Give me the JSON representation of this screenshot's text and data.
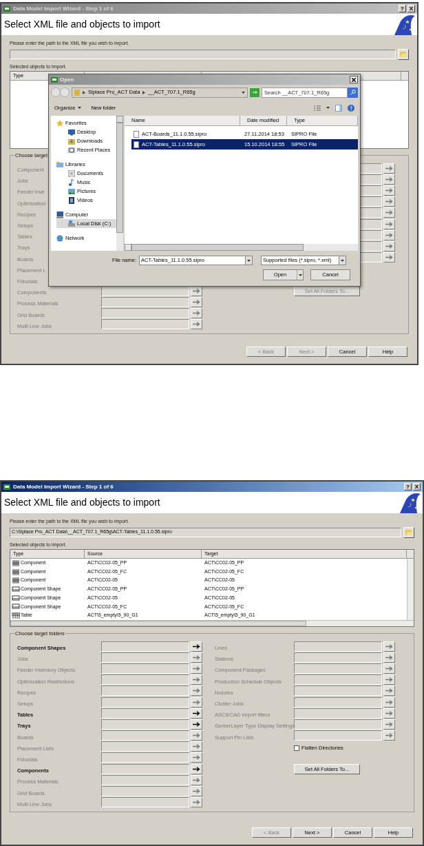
{
  "wizards": [
    {
      "title": "Data Model Import Wizard - Step 1 of 6",
      "active": false,
      "title_buttons": [
        "?",
        "X"
      ],
      "heading": "Select XML file and objects to import",
      "path_label": "Please enter the path to the XML file you wish to import.",
      "objects_label": "Selected objects to import.",
      "columns": [
        "Type"
      ],
      "folders_label": "Choose target",
      "left_folders": [
        {
          "label": "Component",
          "kind": "label_only",
          "enabled": false
        },
        {
          "label": "Jobs",
          "kind": "label_only",
          "enabled": false
        },
        {
          "label": "Feeder Inve",
          "kind": "label_only",
          "enabled": false
        },
        {
          "label": "Optimization",
          "kind": "label_only",
          "enabled": false
        },
        {
          "label": "Recipes",
          "kind": "label_only",
          "enabled": false
        },
        {
          "label": "Setups",
          "kind": "label_only",
          "enabled": false
        },
        {
          "label": "Tables",
          "kind": "label_only",
          "enabled": false
        },
        {
          "label": "Trays",
          "kind": "label_only",
          "enabled": false
        },
        {
          "label": "Boards",
          "kind": "label_only",
          "enabled": false
        },
        {
          "label": "Placement L",
          "kind": "label_only",
          "enabled": false
        },
        {
          "label": "Fiducials",
          "kind": "label_only",
          "enabled": false
        },
        {
          "label": "Components",
          "kind": "full",
          "enabled": false
        },
        {
          "label": "Process Materials",
          "kind": "full",
          "enabled": false
        },
        {
          "label": "Grid Boards",
          "kind": "full",
          "enabled": false
        },
        {
          "label": "Multi Line Jobs",
          "kind": "full",
          "enabled": false
        }
      ],
      "right_folders": [
        {
          "enabled": false
        },
        {
          "enabled": false
        },
        {
          "enabled": false
        },
        {
          "enabled": false
        },
        {
          "enabled": false
        },
        {
          "enabled": false
        },
        {
          "enabled": false
        },
        {
          "enabled": false
        },
        {
          "enabled": false
        }
      ],
      "set_all": {
        "label": "Set All Folders To...",
        "disabled": true
      },
      "buttons": [
        {
          "label": "< Back",
          "disabled": true
        },
        {
          "label": "Next >",
          "disabled": true
        },
        {
          "label": "Cancel",
          "disabled": false
        },
        {
          "label": "Help",
          "disabled": false
        }
      ],
      "open_dialog": {
        "title": "Open",
        "breadcrumb": [
          "Siplace Pro_ACT Data",
          "__ACT_707.1_R65g"
        ],
        "search_placeholder": "Search __ACT_707.1_R65g",
        "toolbar": [
          "Organize",
          "New folder"
        ],
        "nav": [
          {
            "label": "Favorites",
            "kind": "star",
            "selected": false,
            "children": [
              {
                "label": "Desktop",
                "kind": "desktop",
                "selected": false
              },
              {
                "label": "Downloads",
                "kind": "downloads",
                "selected": false
              },
              {
                "label": "Recent Places",
                "kind": "recent",
                "selected": false
              }
            ]
          },
          {
            "label": "Libraries",
            "kind": "library",
            "selected": false,
            "children": [
              {
                "label": "Documents",
                "kind": "documents",
                "selected": false
              },
              {
                "label": "Music",
                "kind": "music",
                "selected": false
              },
              {
                "label": "Pictures",
                "kind": "pictures",
                "selected": false
              },
              {
                "label": "Videos",
                "kind": "videos",
                "selected": false
              }
            ]
          },
          {
            "label": "Computer",
            "kind": "computer",
            "selected": false,
            "children": [
              {
                "label": "Local Disk (C:)",
                "kind": "disk",
                "selected": true
              }
            ]
          },
          {
            "label": "Network",
            "kind": "network",
            "selected": false
          }
        ],
        "columns": [
          "Name",
          "Date modified",
          "Type"
        ],
        "files": [
          {
            "name": "ACT-Boards_11.1.0.55.sipro",
            "date": "27.11.2014 18:53",
            "type": "SIPRO File",
            "selected": false
          },
          {
            "name": "ACT-Tables_11.1.0.55.sipro",
            "date": "15.10.2014 18:55",
            "type": "SIPRO File",
            "selected": true
          }
        ],
        "file_name_label": "File name:",
        "file_name": "ACT-Tables_11.1.0.55.sipro",
        "filter": "Supported files (*.sipro, *.xml)",
        "buttons": [
          "Open",
          "Cancel"
        ]
      }
    },
    {
      "title": "Data Model Import Wizard - Step 1 of 6",
      "active": true,
      "title_buttons": [
        "?",
        "X"
      ],
      "heading": "Select XML file and objects to import",
      "path_label": "Please enter the path to the XML file you wish to import.",
      "path_value": "C:\\Siplace Pro_ACT Data\\__ACT_707.1_R65g\\ACT-Tables_11.1.0.55.sipro",
      "objects_label": "Selected objects to import.",
      "columns": [
        "Type",
        "Source",
        "Target"
      ],
      "rows": [
        {
          "kind": "component",
          "type": "Component",
          "source": "ACT\\CC02-05_PP",
          "target": "ACT\\CC02-05_PP"
        },
        {
          "kind": "component",
          "type": "Component",
          "source": "ACT\\CC02-05_FC",
          "target": "ACT\\CC02-05_FC"
        },
        {
          "kind": "component",
          "type": "Component",
          "source": "ACT\\CC02-05",
          "target": "ACT\\CC02-05"
        },
        {
          "kind": "shape",
          "type": "Component Shape",
          "source": "ACT\\CC02-05_PP",
          "target": "ACT\\CC02-05_PP"
        },
        {
          "kind": "shape",
          "type": "Component Shape",
          "source": "ACT\\CC02-05",
          "target": "ACT\\CC02-05"
        },
        {
          "kind": "shape",
          "type": "Component Shape",
          "source": "ACT\\CC02-05_FC",
          "target": "ACT\\CC02-05_FC"
        },
        {
          "kind": "table",
          "type": "Table",
          "source": "ACT\\5_empty\\5_90_G1",
          "target": "ACT\\5_empty\\5_90_G1"
        }
      ],
      "folders_label": "Choose target folders",
      "left_folders": [
        {
          "label": "Component Shapes",
          "kind": "full",
          "enabled": true
        },
        {
          "label": "Jobs",
          "kind": "full",
          "enabled": false
        },
        {
          "label": "Feeder Inventory Objects",
          "kind": "full",
          "enabled": false
        },
        {
          "label": "Optimization Restrictions",
          "kind": "full",
          "enabled": false
        },
        {
          "label": "Recipes",
          "kind": "full",
          "enabled": false
        },
        {
          "label": "Setups",
          "kind": "full",
          "enabled": false
        },
        {
          "label": "Tables",
          "kind": "full",
          "enabled": true
        },
        {
          "label": "Trays",
          "kind": "full",
          "enabled": true
        },
        {
          "label": "Boards",
          "kind": "full",
          "enabled": false
        },
        {
          "label": "Placement Lists",
          "kind": "full",
          "enabled": false
        },
        {
          "label": "Fiducials",
          "kind": "full",
          "enabled": false
        },
        {
          "label": "Components",
          "kind": "full",
          "enabled": true
        },
        {
          "label": "Process Materials",
          "kind": "full",
          "enabled": false
        },
        {
          "label": "Grid Boards",
          "kind": "full",
          "enabled": false
        },
        {
          "label": "Multi Line Jobs",
          "kind": "full",
          "enabled": false
        }
      ],
      "right_folders": [
        {
          "label": "Lines",
          "enabled": false
        },
        {
          "label": "Stations",
          "enabled": false
        },
        {
          "label": "Component Packages",
          "enabled": false
        },
        {
          "label": "Production Schedule Objects",
          "enabled": false
        },
        {
          "label": "Nozzles",
          "enabled": false
        },
        {
          "label": "Cluster Jobs",
          "enabled": false
        },
        {
          "label": "ASCII/CAD import filters",
          "enabled": false
        },
        {
          "label": "GerberLayer Type Display Settings",
          "enabled": false
        },
        {
          "label": "Support Pin Lists",
          "enabled": false
        }
      ],
      "flatten": {
        "label": "Flatten Directories",
        "checked": false
      },
      "set_all": {
        "label": "Set All Folders To...",
        "disabled": false
      },
      "buttons": [
        {
          "label": "< Back",
          "disabled": true
        },
        {
          "label": "Next >",
          "disabled": false
        },
        {
          "label": "Cancel",
          "disabled": false
        },
        {
          "label": "Help",
          "disabled": false
        }
      ]
    }
  ]
}
